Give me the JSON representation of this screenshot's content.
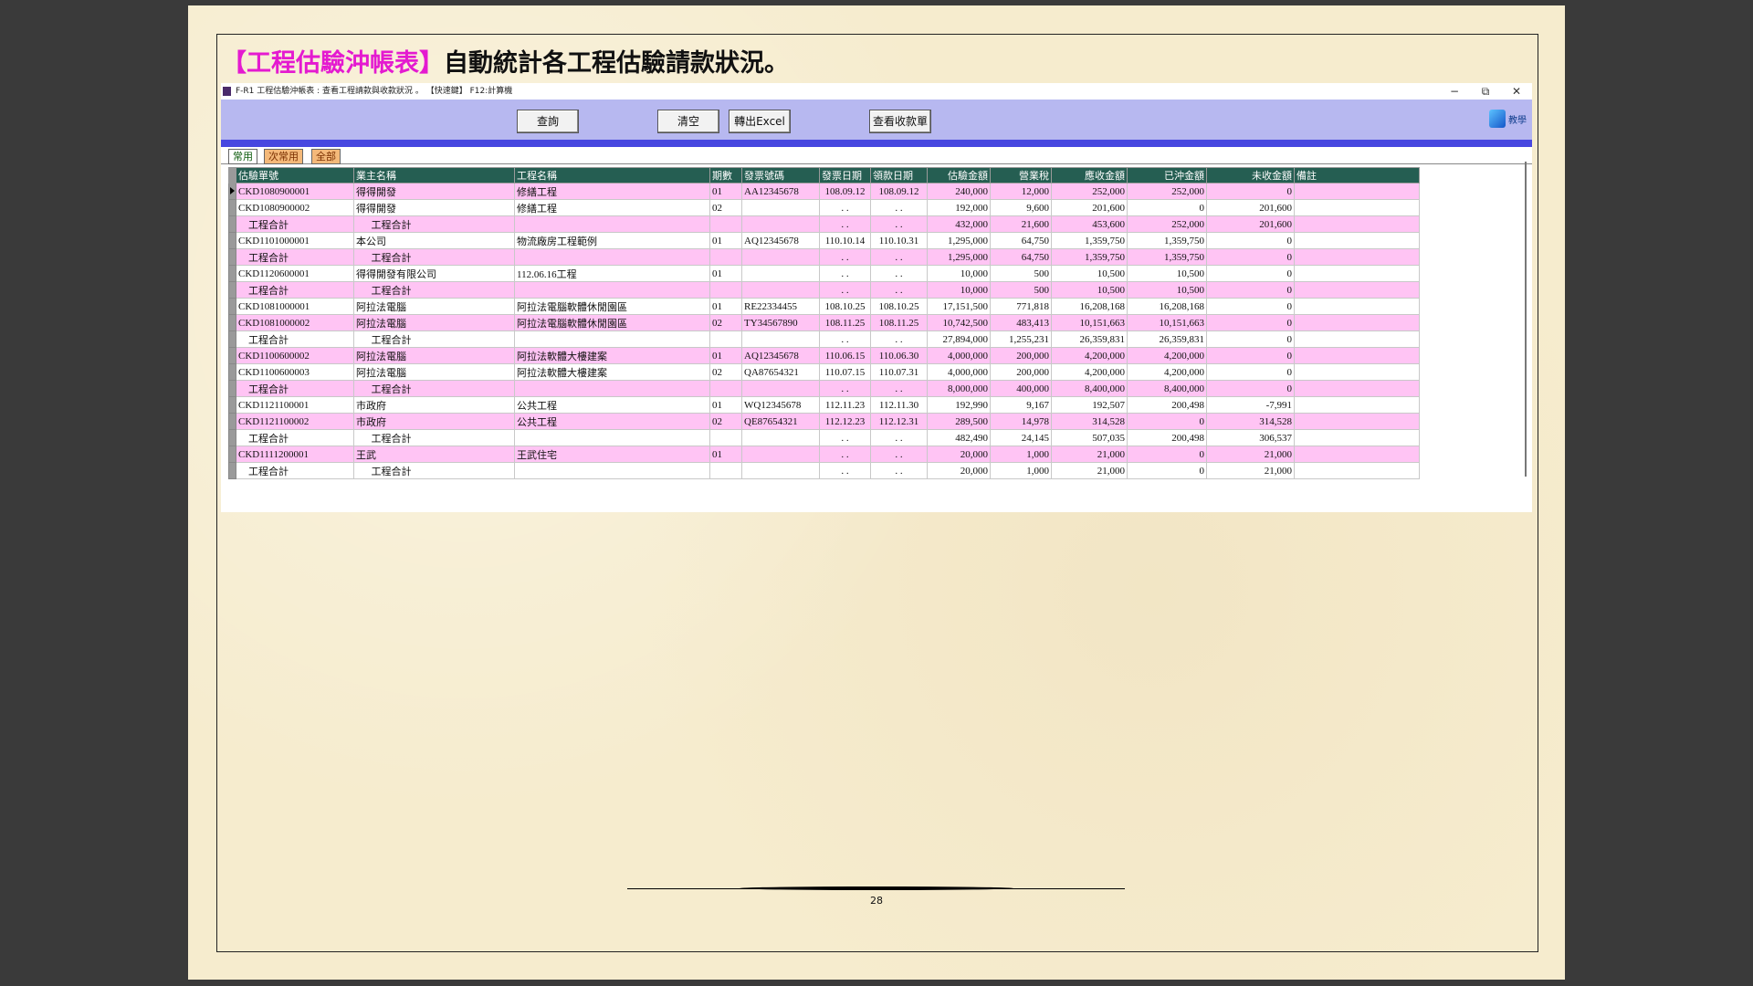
{
  "headline": {
    "highlight": "【工程估驗沖帳表】",
    "text": "自動統計各工程估驗請款狀況。"
  },
  "window": {
    "title": "F-R1 工程估驗沖帳表 : 查看工程請款與收款狀況 。     【快速鍵】 F12:計算機",
    "min": "−",
    "restore": "⧉",
    "close": "✕"
  },
  "toolbar": {
    "query": "查詢",
    "clear": "清空",
    "export": "轉出Excel",
    "receipts": "查看收款單",
    "help": "教學"
  },
  "tabs": [
    "常用",
    "次常用",
    "全部"
  ],
  "columns": [
    "估驗單號",
    "業主名稱",
    "工程名稱",
    "期數",
    "發票號碼",
    "發票日期",
    "領款日期",
    "估驗金額",
    "營業稅",
    "應收金額",
    "已沖金額",
    "未收金額",
    "備註"
  ],
  "rows": [
    {
      "t": "pink",
      "cur": true,
      "c": [
        "CKD1080900001",
        "得得開發",
        "修繕工程",
        "01",
        "AA12345678",
        "108.09.12",
        "108.09.12",
        "240,000",
        "12,000",
        "252,000",
        "252,000",
        "0",
        ""
      ]
    },
    {
      "t": "white",
      "c": [
        "CKD1080900002",
        "得得開發",
        "修繕工程",
        "02",
        "",
        ". .",
        ". .",
        "192,000",
        "9,600",
        "201,600",
        "0",
        "201,600",
        ""
      ]
    },
    {
      "t": "pink",
      "c": [
        "    工程合計",
        "      工程合計",
        "",
        "",
        "",
        ". .",
        ". .",
        "432,000",
        "21,600",
        "453,600",
        "252,000",
        "201,600",
        ""
      ]
    },
    {
      "t": "white",
      "c": [
        "CKD1101000001",
        "本公司",
        "物流廠房工程範例",
        "01",
        "AQ12345678",
        "110.10.14",
        "110.10.31",
        "1,295,000",
        "64,750",
        "1,359,750",
        "1,359,750",
        "0",
        ""
      ]
    },
    {
      "t": "pink",
      "c": [
        "    工程合計",
        "      工程合計",
        "",
        "",
        "",
        ". .",
        ". .",
        "1,295,000",
        "64,750",
        "1,359,750",
        "1,359,750",
        "0",
        ""
      ]
    },
    {
      "t": "white",
      "c": [
        "CKD1120600001",
        "得得開發有限公司",
        "112.06.16工程",
        "01",
        "",
        ". .",
        ". .",
        "10,000",
        "500",
        "10,500",
        "10,500",
        "0",
        ""
      ]
    },
    {
      "t": "pink",
      "c": [
        "    工程合計",
        "      工程合計",
        "",
        "",
        "",
        ". .",
        ". .",
        "10,000",
        "500",
        "10,500",
        "10,500",
        "0",
        ""
      ]
    },
    {
      "t": "white",
      "c": [
        "CKD1081000001",
        "阿拉法電腦",
        "阿拉法電腦軟體休閒園區",
        "01",
        "RE22334455",
        "108.10.25",
        "108.10.25",
        "17,151,500",
        "771,818",
        "16,208,168",
        "16,208,168",
        "0",
        ""
      ]
    },
    {
      "t": "pink",
      "c": [
        "CKD1081000002",
        "阿拉法電腦",
        "阿拉法電腦軟體休閒園區",
        "02",
        "TY34567890",
        "108.11.25",
        "108.11.25",
        "10,742,500",
        "483,413",
        "10,151,663",
        "10,151,663",
        "0",
        ""
      ]
    },
    {
      "t": "white",
      "c": [
        "    工程合計",
        "      工程合計",
        "",
        "",
        "",
        ". .",
        ". .",
        "27,894,000",
        "1,255,231",
        "26,359,831",
        "26,359,831",
        "0",
        ""
      ]
    },
    {
      "t": "pink",
      "c": [
        "CKD1100600002",
        "阿拉法電腦",
        "阿拉法軟體大樓建案",
        "01",
        "AQ12345678",
        "110.06.15",
        "110.06.30",
        "4,000,000",
        "200,000",
        "4,200,000",
        "4,200,000",
        "0",
        ""
      ]
    },
    {
      "t": "white",
      "c": [
        "CKD1100600003",
        "阿拉法電腦",
        "阿拉法軟體大樓建案",
        "02",
        "QA87654321",
        "110.07.15",
        "110.07.31",
        "4,000,000",
        "200,000",
        "4,200,000",
        "4,200,000",
        "0",
        ""
      ]
    },
    {
      "t": "pink",
      "c": [
        "    工程合計",
        "      工程合計",
        "",
        "",
        "",
        ". .",
        ". .",
        "8,000,000",
        "400,000",
        "8,400,000",
        "8,400,000",
        "0",
        ""
      ]
    },
    {
      "t": "white",
      "c": [
        "CKD1121100001",
        "市政府",
        "公共工程",
        "01",
        "WQ12345678",
        "112.11.23",
        "112.11.30",
        "192,990",
        "9,167",
        "192,507",
        "200,498",
        "-7,991",
        ""
      ]
    },
    {
      "t": "pink",
      "c": [
        "CKD1121100002",
        "市政府",
        "公共工程",
        "02",
        "QE87654321",
        "112.12.23",
        "112.12.31",
        "289,500",
        "14,978",
        "314,528",
        "0",
        "314,528",
        ""
      ]
    },
    {
      "t": "white",
      "c": [
        "    工程合計",
        "      工程合計",
        "",
        "",
        "",
        ". .",
        ". .",
        "482,490",
        "24,145",
        "507,035",
        "200,498",
        "306,537",
        ""
      ]
    },
    {
      "t": "pink",
      "c": [
        "CKD1111200001",
        "王武",
        "王武住宅",
        "01",
        "",
        ". .",
        ". .",
        "20,000",
        "1,000",
        "21,000",
        "0",
        "21,000",
        ""
      ]
    },
    {
      "t": "white",
      "c": [
        "    工程合計",
        "      工程合計",
        "",
        "",
        "",
        ". .",
        ". .",
        "20,000",
        "1,000",
        "21,000",
        "0",
        "21,000",
        ""
      ]
    }
  ],
  "page_number": "28"
}
